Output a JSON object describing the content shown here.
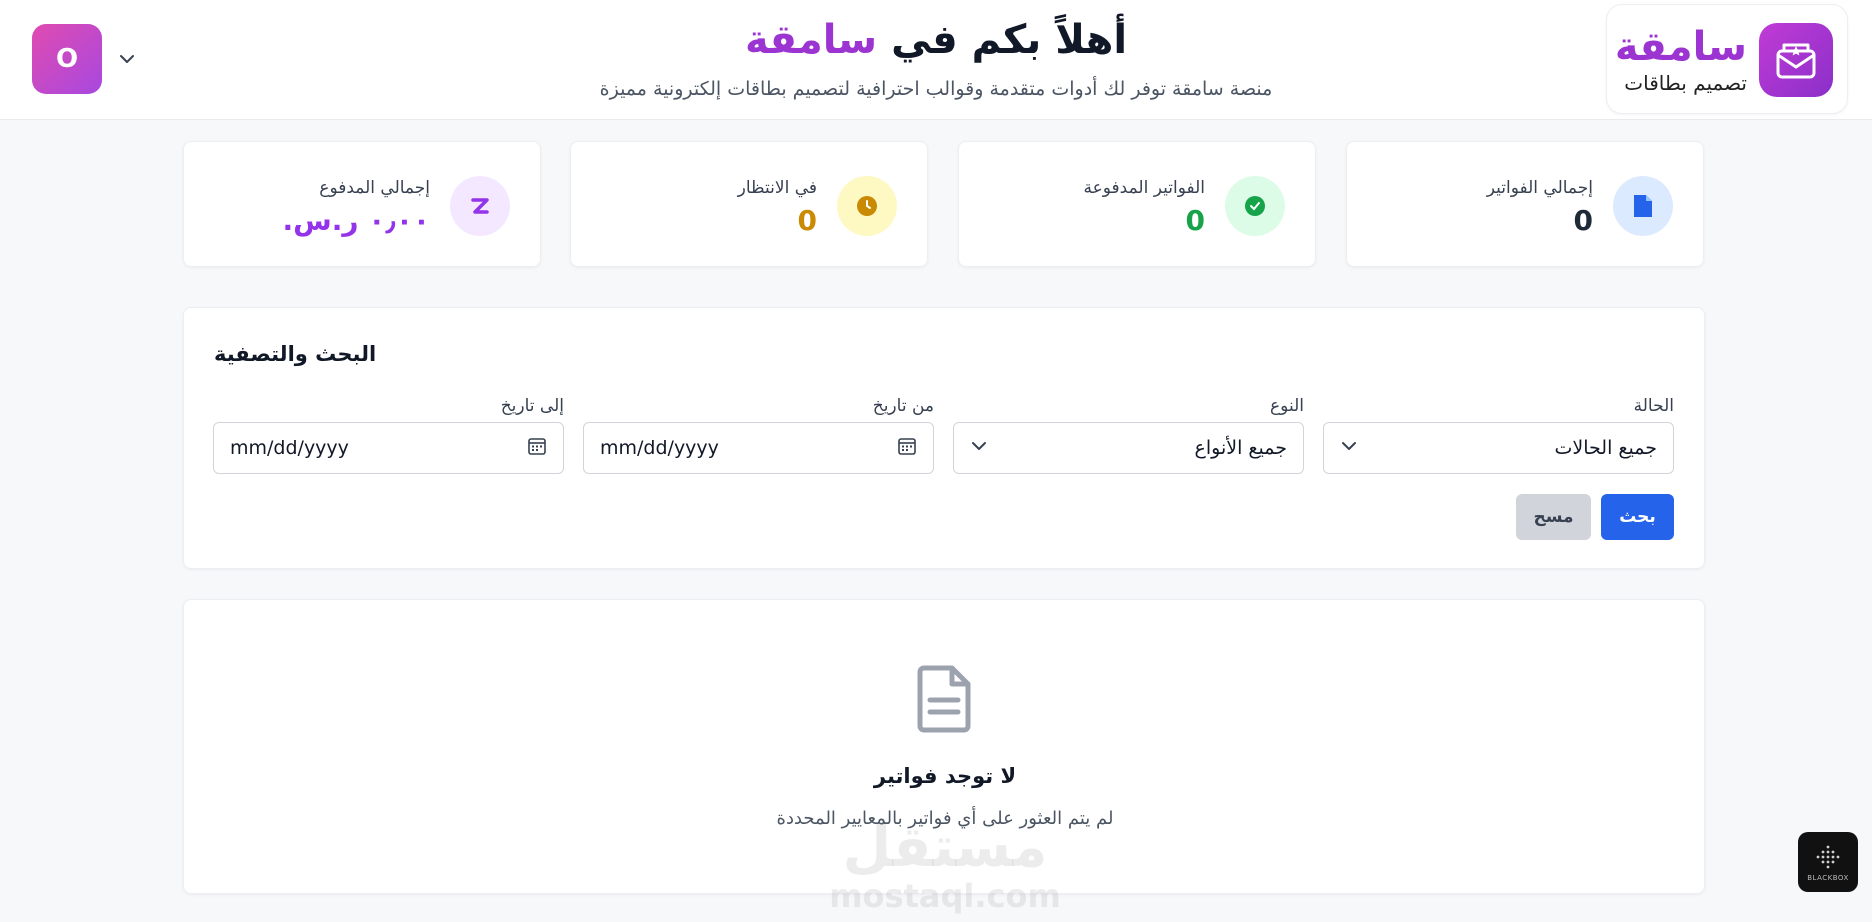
{
  "header": {
    "logo_name": "سامقة",
    "logo_sub": "تصميم بطاقات",
    "welcome_prefix": "أهلاً بكم في",
    "welcome_brand": "سامقة",
    "subtitle": "منصة سامقة توفر لك أدوات متقدمة وقوالب احترافية لتصميم بطاقات إلكترونية مميزة",
    "avatar_letter": "O"
  },
  "stats": [
    {
      "label": "إجمالي الفواتير",
      "value": "0",
      "icon": "document-icon",
      "color": "#1f2937",
      "bg": "#dbeafe",
      "icon_color": "#2563eb"
    },
    {
      "label": "الفواتير المدفوعة",
      "value": "0",
      "icon": "check-circle-icon",
      "color": "#16a34a",
      "bg": "#dcfce7",
      "icon_color": "#16a34a"
    },
    {
      "label": "في الانتظار",
      "value": "0",
      "icon": "clock-icon",
      "color": "#ca8a04",
      "bg": "#fef9c3",
      "icon_color": "#ca8a04"
    },
    {
      "label": "إجمالي المدفوع",
      "value": "٠٫٠٠ ر.س.",
      "icon": "money-icon",
      "color": "#9333ea",
      "bg": "#f3e8ff",
      "icon_color": "#9333ea"
    }
  ],
  "filter": {
    "title": "البحث والتصفية",
    "status_label": "الحالة",
    "status_value": "جميع الحالات",
    "type_label": "النوع",
    "type_value": "جميع الأنواع",
    "from_label": "من تاريخ",
    "from_placeholder": "mm/dd/yyyy",
    "to_label": "إلى تاريخ",
    "to_placeholder": "mm/dd/yyyy",
    "search_label": "بحث",
    "clear_label": "مسح"
  },
  "empty": {
    "title": "لا توجد فواتير",
    "description": "لم يتم العثور على أي فواتير بالمعايير المحددة"
  },
  "watermark": {
    "arabic": "مستقل",
    "latin": "mostaql.com"
  },
  "badge": {
    "label": "BLACKBOX"
  }
}
